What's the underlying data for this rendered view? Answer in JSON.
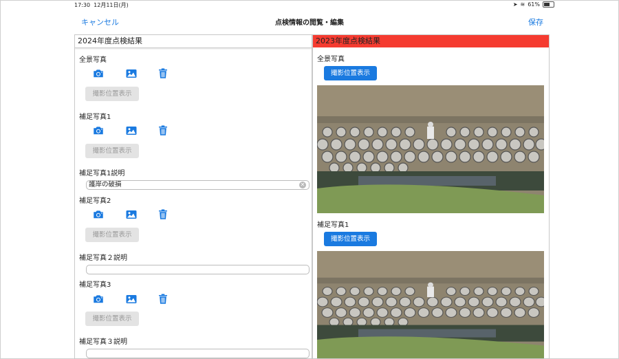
{
  "status": {
    "time": "17:30",
    "date": "12月11日(月)",
    "battery": "61%"
  },
  "nav": {
    "cancel": "キャンセル",
    "title": "点検情報の閲覧・編集",
    "save": "保存"
  },
  "left": {
    "header": "2024年度点検結果",
    "sections": [
      {
        "label": "全景写真",
        "location_btn": "撮影位置表示"
      },
      {
        "label": "補足写真1",
        "location_btn": "撮影位置表示"
      },
      {
        "label": "補足写真2",
        "location_btn": "撮影位置表示"
      },
      {
        "label": "補足写真3",
        "location_btn": "撮影位置表示"
      }
    ],
    "desc1": {
      "label": "補足写真1説明",
      "value": "護岸の破損"
    },
    "desc2": {
      "label": "補足写真２説明",
      "value": ""
    },
    "desc3": {
      "label": "補足写真３説明",
      "value": ""
    }
  },
  "right": {
    "header": "2023年度点検結果",
    "sections": [
      {
        "label": "全景写真",
        "location_btn": "撮影位置表示"
      },
      {
        "label": "補足写真1",
        "location_btn": "撮影位置表示"
      }
    ]
  },
  "icons": {
    "camera": "camera-icon",
    "gallery": "photo-library-icon",
    "trash": "trash-icon"
  },
  "colors": {
    "accent": "#1a7ae0",
    "header_2023": "#f53b30",
    "disabled_btn": "#e3e3e3"
  }
}
